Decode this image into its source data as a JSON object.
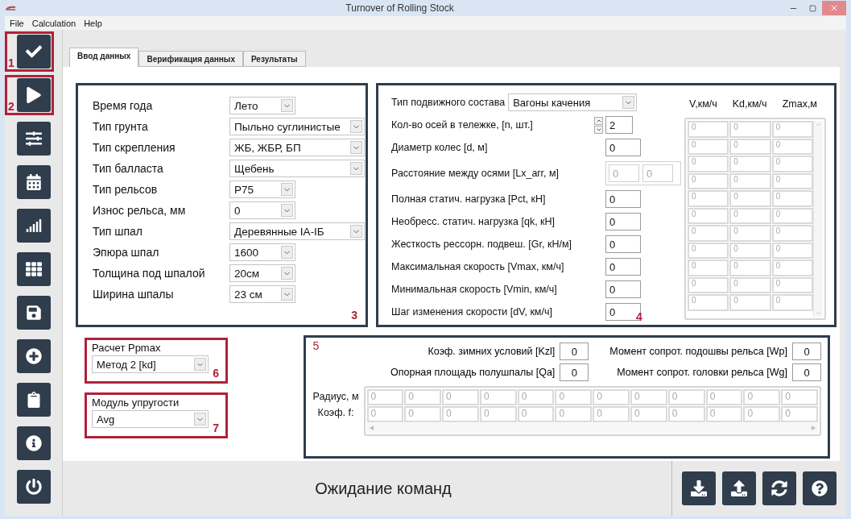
{
  "window": {
    "title": "Turnover of Rolling Stock"
  },
  "menu": [
    {
      "label": "File"
    },
    {
      "label": "Calculation"
    },
    {
      "label": "Help"
    }
  ],
  "toolbar": [
    {
      "kind": "check",
      "highlight": true,
      "callout": "1"
    },
    {
      "kind": "play",
      "highlight": true,
      "callout": "2"
    },
    {
      "kind": "sliders",
      "highlight": false
    },
    {
      "kind": "calendar",
      "highlight": false
    },
    {
      "kind": "bars",
      "highlight": false
    },
    {
      "kind": "grid",
      "highlight": false
    },
    {
      "kind": "save",
      "highlight": false
    },
    {
      "kind": "plus",
      "highlight": false
    },
    {
      "kind": "clipboard",
      "highlight": false
    },
    {
      "kind": "info",
      "highlight": false
    },
    {
      "kind": "power",
      "highlight": false
    }
  ],
  "tabs": [
    {
      "label": "Ввод данных",
      "selected": true
    },
    {
      "label": "Верификация данных",
      "selected": false
    },
    {
      "label": "Результаты",
      "selected": false
    }
  ],
  "track_panel": {
    "callout": "3",
    "highlight": false,
    "fields": [
      {
        "label": "Время года",
        "value": "Лето",
        "kind": "narrow"
      },
      {
        "label": "Тип грунта",
        "value": "Пыльно суглинистые",
        "kind": "wide"
      },
      {
        "label": "Тип скрепления",
        "value": "ЖБ, ЖБР, БП",
        "kind": "wide"
      },
      {
        "label": "Тип балласта",
        "value": "Щебень",
        "kind": "wide"
      },
      {
        "label": "Тип рельсов",
        "value": "Р75",
        "kind": "narrow"
      },
      {
        "label": "Износ рельса, мм",
        "value": "0",
        "kind": "narrow"
      },
      {
        "label": "Тип шпал",
        "value": "Деревянные IA-IБ",
        "kind": "wide"
      },
      {
        "label": "Эпюра шпал",
        "value": "1600",
        "kind": "narrow"
      },
      {
        "label": "Толщина под шпалой",
        "value": "20см",
        "kind": "narrow"
      },
      {
        "label": "Ширина шпалы",
        "value": "23 см",
        "kind": "narrow"
      }
    ]
  },
  "rolling_panel": {
    "callout": "4",
    "highlight": false,
    "fields": [
      {
        "kind": "select",
        "label": "Тип подвижного состава",
        "value": "Вагоны качения"
      },
      {
        "kind": "spinner",
        "label": "Кол-во осей в тележке, [n, шт.]",
        "value": "2"
      },
      {
        "kind": "number",
        "label": "Диаметр колес [d, м]",
        "value": "0"
      },
      {
        "kind": "pair",
        "label": "Расстояние между осями [Lx_arr, м]",
        "values": [
          "0",
          "0"
        ],
        "disabled": true
      },
      {
        "kind": "number",
        "label": "Полная статич. нагрузка [Pct, кН]",
        "value": "0"
      },
      {
        "kind": "number",
        "label": "Необресс. статич. нагрузка [qk, кН]",
        "value": "0"
      },
      {
        "kind": "number",
        "label": "Жесткость рессорн. подвеш. [Gr, кН/м]",
        "value": "0"
      },
      {
        "kind": "number",
        "label": "Максимальная скорость [Vmax, км/ч]",
        "value": "0"
      },
      {
        "kind": "number",
        "label": "Минимальная скорость [Vmin, км/ч]",
        "value": "0"
      },
      {
        "kind": "number",
        "label": "Шаг изменения скорости [dV, км/ч]",
        "value": "0"
      }
    ],
    "table": {
      "disabled": true,
      "columns": [
        "V,км/ч",
        "Kd,км/ч",
        "Zmax,м"
      ],
      "rows": [
        [
          "0",
          "0",
          "0"
        ],
        [
          "0",
          "0",
          "0"
        ],
        [
          "0",
          "0",
          "0"
        ],
        [
          "0",
          "0",
          "0"
        ],
        [
          "0",
          "0",
          "0"
        ],
        [
          "0",
          "0",
          "0"
        ],
        [
          "0",
          "0",
          "0"
        ],
        [
          "0",
          "0",
          "0"
        ],
        [
          "0",
          "0",
          "0"
        ],
        [
          "0",
          "0",
          "0"
        ],
        [
          "0",
          "0",
          "0"
        ]
      ]
    }
  },
  "ppmax_panel": {
    "callout": "6",
    "highlight": true,
    "label": "Расчет Ppmax",
    "value": "Метод 2 [kd]"
  },
  "elastic_panel": {
    "callout": "7",
    "highlight": true,
    "label": "Модуль упругости",
    "value": "Avg"
  },
  "rail_panel": {
    "callout": "5",
    "highlight": false,
    "params": [
      {
        "label": "Коэф. зимних условий [Kzl]",
        "value": "0"
      },
      {
        "label": "Момент сопрот. подошвы рельса [Wp]",
        "value": "0"
      },
      {
        "label": "Опорная площадь полушпалы [Qa]",
        "value": "0"
      },
      {
        "label": "Момент сопрот. головки рельса [Wg]",
        "value": "0"
      }
    ],
    "grid": {
      "disabled": true,
      "rows": [
        {
          "label": "Радиус, м",
          "cells": [
            "0",
            "0",
            "0",
            "0",
            "0",
            "0",
            "0",
            "0",
            "0",
            "0",
            "0",
            "0"
          ]
        },
        {
          "label": "Коэф. f:",
          "cells": [
            "0",
            "0",
            "0",
            "0",
            "0",
            "0",
            "0",
            "0",
            "0",
            "0",
            "0",
            "0"
          ]
        }
      ]
    }
  },
  "status_bar": {
    "text": "Ожидание команд",
    "buttons": [
      {
        "kind": "download"
      },
      {
        "kind": "upload"
      },
      {
        "kind": "refresh"
      },
      {
        "kind": "help"
      }
    ]
  }
}
